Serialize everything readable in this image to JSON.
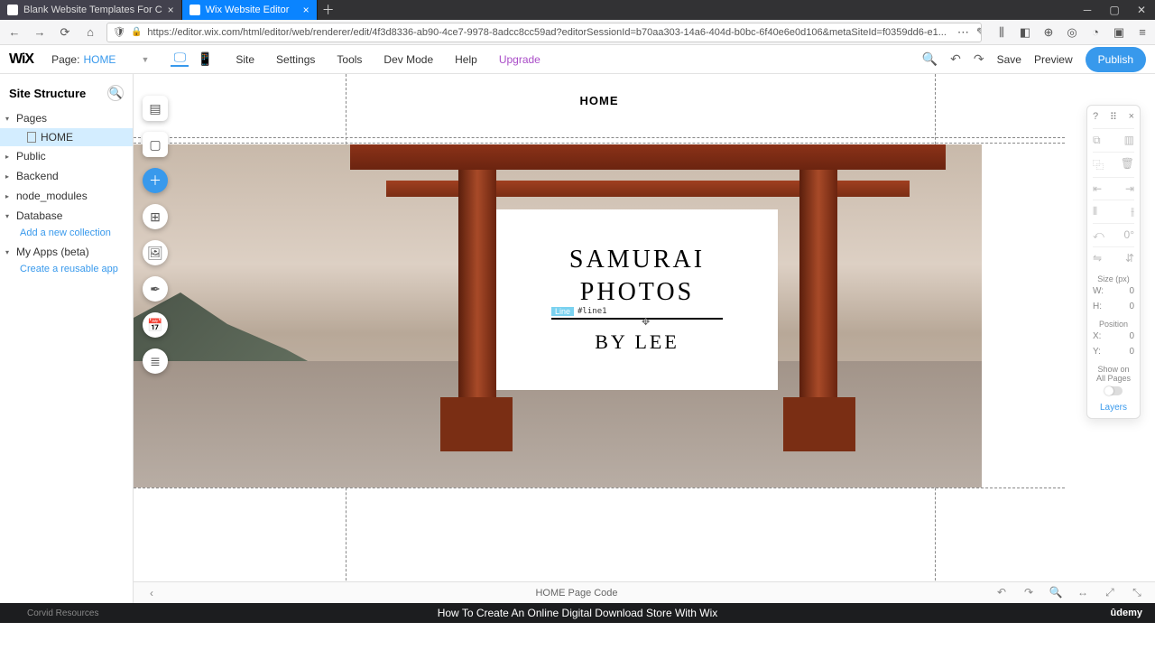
{
  "browser": {
    "tabs": [
      {
        "title": "Blank Website Templates For C",
        "active": false
      },
      {
        "title": "Wix Website Editor",
        "active": true
      }
    ],
    "url": "https://editor.wix.com/html/editor/web/renderer/edit/4f3d8336-ab90-4ce7-9978-8adcc8cc59ad?editorSessionId=b70aa303-14a6-404d-b0bc-6f40e6e0d106&metaSiteId=f0359dd6-e1..."
  },
  "wixbar": {
    "logo": "WiX",
    "page_label": "Page:",
    "page_name": "HOME",
    "menu": [
      "Site",
      "Settings",
      "Tools",
      "Dev Mode",
      "Help",
      "Upgrade"
    ],
    "actions": {
      "save": "Save",
      "preview": "Preview",
      "publish": "Publish"
    }
  },
  "sidebar": {
    "title": "Site Structure",
    "items": [
      {
        "label": "Pages",
        "open": true,
        "children": [
          {
            "label": "HOME"
          }
        ]
      },
      {
        "label": "Public"
      },
      {
        "label": "Backend"
      },
      {
        "label": "node_modules"
      },
      {
        "label": "Database",
        "open": true,
        "link": "Add a new collection"
      },
      {
        "label": "My Apps (beta)",
        "open": true,
        "link": "Create a reusable app"
      }
    ]
  },
  "canvas": {
    "nav": "HOME",
    "card": {
      "title1": "SAMURAI",
      "title2": "PHOTOS",
      "sel_type": "Line",
      "sel_id": "#line1",
      "byline": "BY LEE"
    }
  },
  "inspector": {
    "size_label": "Size (px)",
    "w_label": "W:",
    "w_val": "0",
    "h_label": "H:",
    "h_val": "0",
    "pos_label": "Position",
    "x_label": "X:",
    "x_val": "0",
    "y_label": "Y:",
    "y_val": "0",
    "show_label": "Show on All Pages",
    "layers": "Layers"
  },
  "codebar": {
    "title": "HOME Page Code"
  },
  "footer": {
    "corvid": "Corvid Resources",
    "title": "How To Create An Online Digital Download Store With Wix",
    "brand": "ûdemy"
  }
}
